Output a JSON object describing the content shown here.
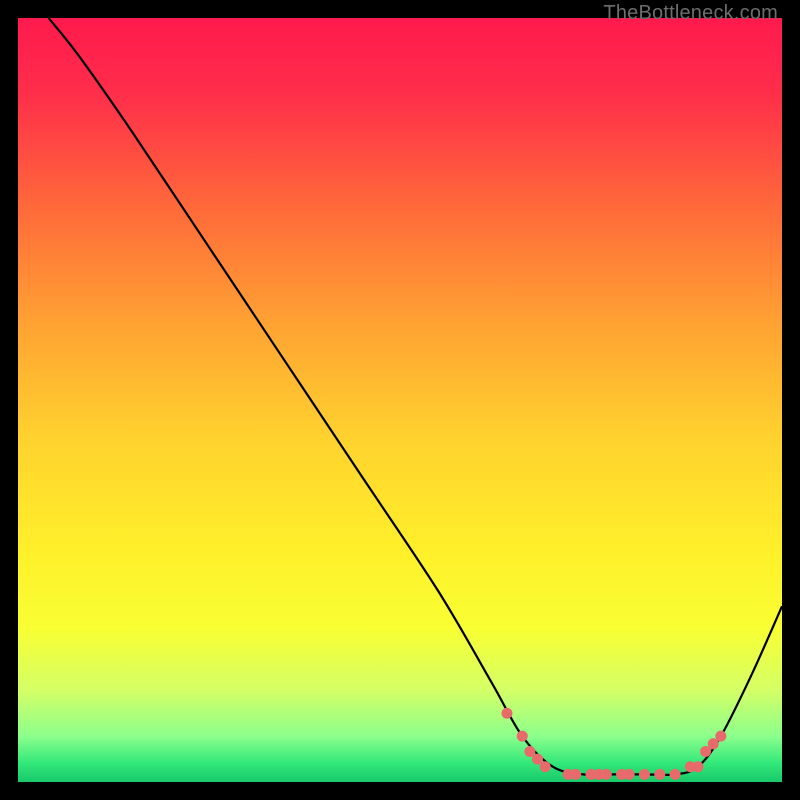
{
  "watermark": "TheBottleneck.com",
  "gradient_stops": [
    {
      "offset": 0.0,
      "color": "#ff1a4d"
    },
    {
      "offset": 0.1,
      "color": "#ff2e4a"
    },
    {
      "offset": 0.25,
      "color": "#ff6a3a"
    },
    {
      "offset": 0.4,
      "color": "#ffa233"
    },
    {
      "offset": 0.55,
      "color": "#ffd22e"
    },
    {
      "offset": 0.7,
      "color": "#fff02a"
    },
    {
      "offset": 0.8,
      "color": "#f8ff33"
    },
    {
      "offset": 0.88,
      "color": "#d4ff66"
    },
    {
      "offset": 0.94,
      "color": "#8cff8c"
    },
    {
      "offset": 0.975,
      "color": "#33e87a"
    },
    {
      "offset": 1.0,
      "color": "#18c96a"
    }
  ],
  "chart_data": {
    "type": "line",
    "title": "",
    "xlabel": "",
    "ylabel": "",
    "xlim": [
      0,
      100
    ],
    "ylim": [
      0,
      100
    ],
    "series": [
      {
        "name": "curve",
        "points": [
          {
            "x": 4,
            "y": 100
          },
          {
            "x": 8,
            "y": 95
          },
          {
            "x": 15,
            "y": 85
          },
          {
            "x": 25,
            "y": 70
          },
          {
            "x": 35,
            "y": 55
          },
          {
            "x": 45,
            "y": 40
          },
          {
            "x": 55,
            "y": 25
          },
          {
            "x": 62,
            "y": 13
          },
          {
            "x": 66,
            "y": 6
          },
          {
            "x": 70,
            "y": 2
          },
          {
            "x": 74,
            "y": 1
          },
          {
            "x": 78,
            "y": 1
          },
          {
            "x": 82,
            "y": 1
          },
          {
            "x": 86,
            "y": 1
          },
          {
            "x": 89,
            "y": 2
          },
          {
            "x": 92,
            "y": 6
          },
          {
            "x": 96,
            "y": 14
          },
          {
            "x": 100,
            "y": 23
          }
        ]
      }
    ],
    "markers": [
      {
        "x": 64,
        "y": 9
      },
      {
        "x": 66,
        "y": 6
      },
      {
        "x": 67,
        "y": 4
      },
      {
        "x": 68,
        "y": 3
      },
      {
        "x": 69,
        "y": 2
      },
      {
        "x": 72,
        "y": 1
      },
      {
        "x": 73,
        "y": 1
      },
      {
        "x": 75,
        "y": 1
      },
      {
        "x": 76,
        "y": 1
      },
      {
        "x": 77,
        "y": 1
      },
      {
        "x": 79,
        "y": 1
      },
      {
        "x": 80,
        "y": 1
      },
      {
        "x": 82,
        "y": 1
      },
      {
        "x": 84,
        "y": 1
      },
      {
        "x": 86,
        "y": 1
      },
      {
        "x": 88,
        "y": 2
      },
      {
        "x": 89,
        "y": 2
      },
      {
        "x": 90,
        "y": 4
      },
      {
        "x": 91,
        "y": 5
      },
      {
        "x": 92,
        "y": 6
      }
    ],
    "marker_color": "#e86a6a",
    "curve_color": "#000000"
  }
}
